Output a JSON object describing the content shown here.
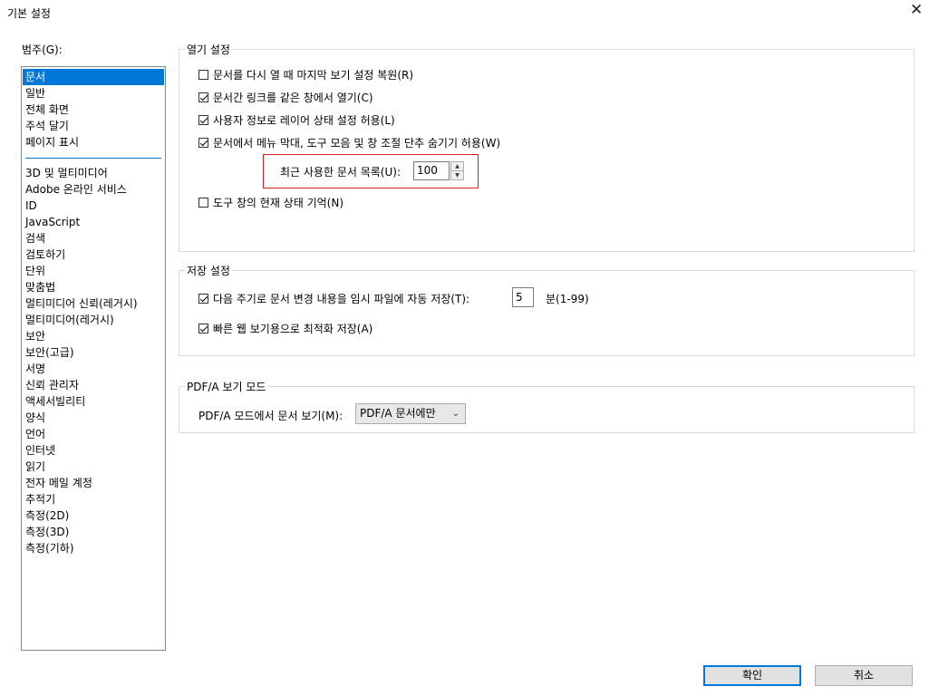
{
  "window": {
    "title": "기본 설정",
    "close_glyph": "✕"
  },
  "categories": {
    "label": "범주(G):",
    "items_top": [
      "문서",
      "일반",
      "전체 화면",
      "주석 달기",
      "페이지 표시"
    ],
    "items_bottom": [
      "3D 및 멀티미디어",
      "Adobe 온라인 서비스",
      "ID",
      "JavaScript",
      "검색",
      "검토하기",
      "단위",
      "맞춤법",
      "멀티미디어 신뢰(레거시)",
      "멀티미디어(레거시)",
      "보안",
      "보안(고급)",
      "서명",
      "신뢰 관리자",
      "액세서빌리티",
      "양식",
      "언어",
      "인터넷",
      "읽기",
      "전자 메일 계정",
      "추적기",
      "측정(2D)",
      "측정(3D)",
      "측정(기하)"
    ],
    "selected": "문서"
  },
  "open_settings": {
    "title": "열기 설정",
    "restore_view": {
      "label": "문서를 다시 열 때 마지막 보기 설정 복원(R)",
      "checked": false
    },
    "same_window": {
      "label": "문서간 링크를 같은 창에서 열기(C)",
      "checked": true
    },
    "layer_state": {
      "label": "사용자 정보로 레이어 상태 설정 허용(L)",
      "checked": true
    },
    "hide_menus": {
      "label": "문서에서 메뉴 막대, 도구 모음 및 창 조절 단추 숨기기 허용(W)",
      "checked": true
    },
    "recent_docs": {
      "label": "최근 사용한 문서 목록(U):",
      "value": "100"
    },
    "remember_tools": {
      "label": "도구 창의 현재 상태 기억(N)",
      "checked": false
    }
  },
  "save_settings": {
    "title": "저장 설정",
    "autosave": {
      "label": "다음 주기로 문서 변경 내용을 임시 파일에 자동 저장(T):",
      "checked": true,
      "value": "5",
      "unit": "분(1-99)"
    },
    "fast_web": {
      "label": "빠른 웹 보기용으로 최적화 저장(A)",
      "checked": true
    }
  },
  "pdfa": {
    "title": "PDF/A 보기 모드",
    "label": "PDF/A 모드에서 문서 보기(M):",
    "selected": "PDF/A 문서에만"
  },
  "buttons": {
    "ok": "확인",
    "cancel": "취소"
  }
}
